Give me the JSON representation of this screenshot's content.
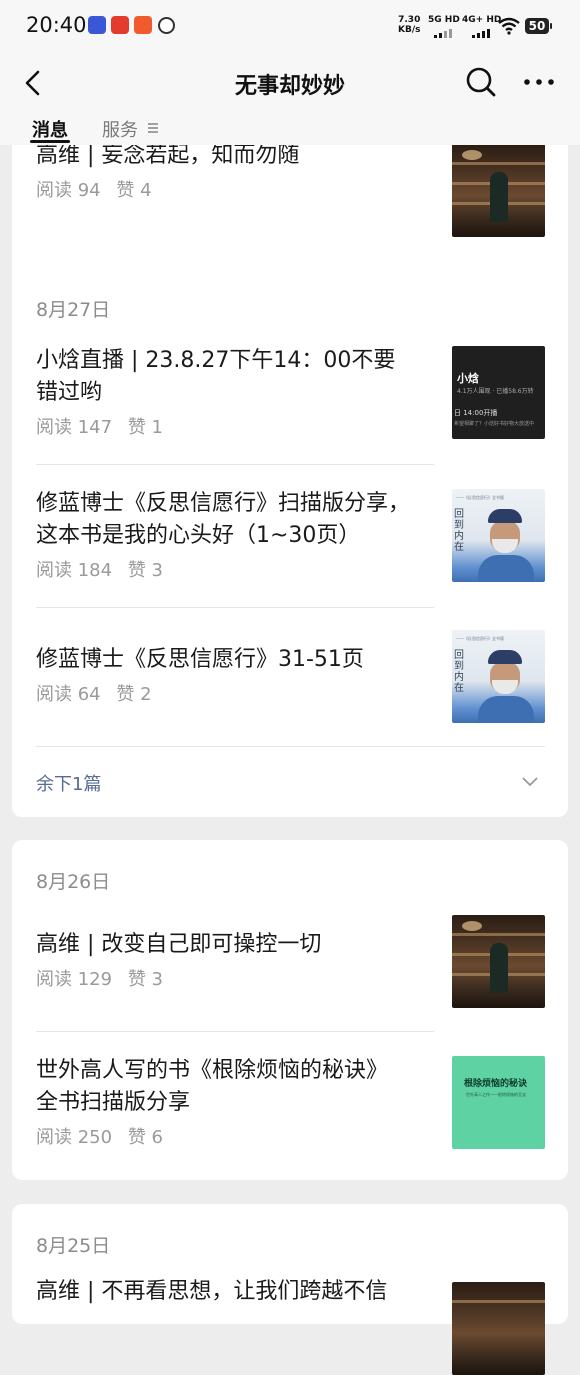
{
  "status_bar": {
    "time": "20:40",
    "net_speed": "7.30",
    "net_unit": "KB/s",
    "sim1": "5G HD",
    "sim2": "4G+ HD",
    "battery": "50"
  },
  "nav": {
    "title": "无事却妙妙",
    "back_icon": "chevron-left-icon",
    "search_icon": "search-icon",
    "more_icon": "more-dots-icon"
  },
  "tabs": [
    {
      "label": "消息",
      "active": true
    },
    {
      "label": "服务",
      "active": false
    }
  ],
  "top_article": {
    "title": "高维 | 妄念若起，知而勿随",
    "reads": "阅读 94",
    "likes": "赞 4"
  },
  "groups": [
    {
      "date": "8月27日",
      "articles": [
        {
          "title_lines": [
            "小焓直播 | 23.8.27下午14：00不要",
            "错过哟"
          ],
          "reads": "阅读 147",
          "likes": "赞 1",
          "thumb": {
            "title": "小焓",
            "sub": "4.1万人围观 · 已播58.6万转",
            "time": "日 14:00开播",
            "note": "希望相聚了？小焓好书好物大放送中"
          }
        },
        {
          "title_lines": [
            "修蓝博士《反思信愿行》扫描版分享，",
            "这本书是我的心头好（1~30页）"
          ],
          "reads": "阅读 184",
          "likes": "赞 3",
          "thumb": {
            "line": "——《反思信愿行》全书版",
            "vertical": "回到内在"
          }
        },
        {
          "title_lines": [
            "修蓝博士《反思信愿行》31-51页"
          ],
          "reads": "阅读 64",
          "likes": "赞 2",
          "thumb": {
            "line": "——《反思信愿行》全书版",
            "vertical": "回到内在"
          }
        }
      ],
      "more_label": "余下1篇"
    },
    {
      "date": "8月26日",
      "articles": [
        {
          "title_lines": [
            "高维 | 改变自己即可操控一切"
          ],
          "reads": "阅读 129",
          "likes": "赞 3"
        },
        {
          "title_lines": [
            "世外高人写的书《根除烦恼的秘诀》",
            "全书扫描版分享"
          ],
          "reads": "阅读 250",
          "likes": "赞 6",
          "thumb": {
            "title": "根除烦恼的秘诀",
            "sub": "世外高人之作——根除烦恼的至宝"
          }
        }
      ]
    },
    {
      "date": "8月25日",
      "articles": [
        {
          "title_lines": [
            "高维 | 不再看思想，让我们跨越不信"
          ],
          "reads": "",
          "likes": ""
        }
      ]
    }
  ],
  "colors": {
    "background": "#ededed",
    "link": "#576b95",
    "muted": "#9a9a9a"
  }
}
